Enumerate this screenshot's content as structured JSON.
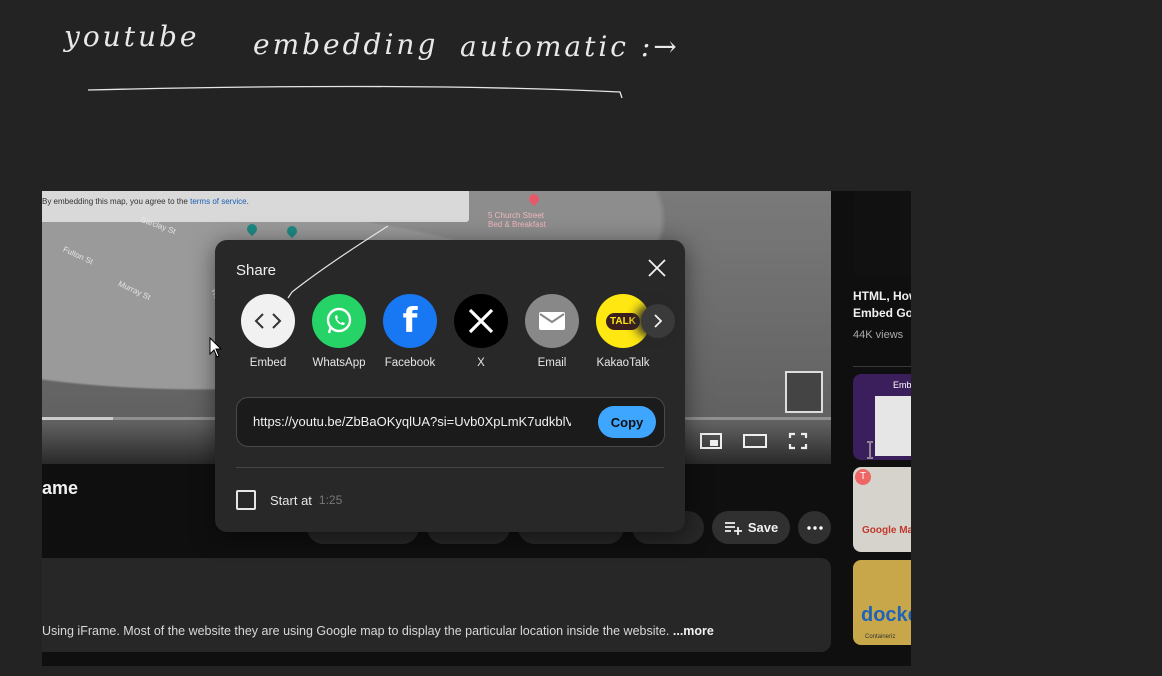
{
  "annotation": {
    "words": [
      "youtube",
      "embedding",
      "automatic :→"
    ]
  },
  "map": {
    "notice_text": "By embedding this map, you agree to the ",
    "notice_link": "terms of service",
    "notice_end": ".",
    "place_label": "5 Church Street\nBed & Breakfast",
    "street_labels": [
      "Fulton St",
      "Murray St",
      "Warren St",
      "Barclay St"
    ]
  },
  "video": {
    "title_fragment": "ame",
    "progress": 0.09,
    "description": "Using iFrame. Most of the website they are using Google map to display the particular location inside the website.",
    "more_label": "...more"
  },
  "actions": {
    "save_label": "Save"
  },
  "share": {
    "title": "Share",
    "targets": [
      {
        "label": "Embed",
        "icon": "embed-code-icon",
        "color": "#f1f1f1"
      },
      {
        "label": "WhatsApp",
        "icon": "whatsapp-icon",
        "color": "#25d366"
      },
      {
        "label": "Facebook",
        "icon": "facebook-icon",
        "color": "#1877f2"
      },
      {
        "label": "X",
        "icon": "x-icon",
        "color": "#000000"
      },
      {
        "label": "Email",
        "icon": "email-icon",
        "color": "#888888"
      },
      {
        "label": "KakaoTalk",
        "icon": "kakaotalk-icon",
        "color": "#ffe812"
      }
    ],
    "url": "https://youtu.be/ZbBaOKyqlUA?si=Uvb0XpLmK7udkblV",
    "copy_label": "Copy",
    "start_at_label": "Start at",
    "start_at_time": "1:25"
  },
  "sidebar": {
    "rec1_title": "HTML, How to\nEmbed Go",
    "rec1_views": "44K views",
    "thumb_texts": [
      "Embed",
      "Google Ma",
      "docke",
      "Containeriz"
    ]
  },
  "colors": {
    "accent": "#3ea6ff",
    "background": "#232323"
  }
}
